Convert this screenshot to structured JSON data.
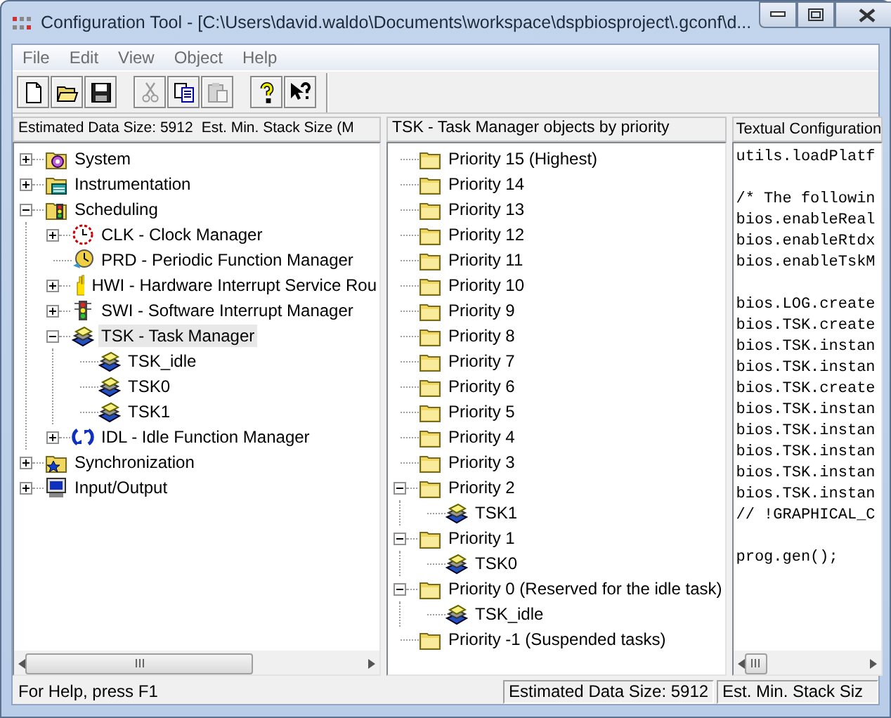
{
  "window": {
    "title": "Configuration Tool - [C:\\Users\\david.waldo\\Documents\\workspace\\dspbiosproject\\.gconf\\d..."
  },
  "menu": [
    "File",
    "Edit",
    "View",
    "Object",
    "Help"
  ],
  "toolbar": [
    {
      "kind": "new",
      "disabled": false
    },
    {
      "kind": "open",
      "disabled": false
    },
    {
      "kind": "save",
      "disabled": false
    },
    {
      "kind": "separator"
    },
    {
      "kind": "cut",
      "disabled": true
    },
    {
      "kind": "copy",
      "disabled": false
    },
    {
      "kind": "paste",
      "disabled": true
    },
    {
      "kind": "separator"
    },
    {
      "kind": "help",
      "disabled": false
    },
    {
      "kind": "context-help",
      "disabled": false
    }
  ],
  "left_pane": {
    "header": "Estimated Data Size: 5912",
    "header_2": "Est. Min. Stack Size (M",
    "tree": [
      {
        "label": "System",
        "kind": "system",
        "expanded": false,
        "selected": false
      },
      {
        "label": "Instrumentation",
        "kind": "instrumentation",
        "expanded": false,
        "selected": false
      },
      {
        "label": "Scheduling",
        "kind": "scheduling",
        "expanded": true,
        "selected": false,
        "children": [
          {
            "label": "CLK - Clock Manager",
            "kind": "clock",
            "expanded": false,
            "selected": false
          },
          {
            "label": "PRD - Periodic Function Manager",
            "kind": "periodic",
            "selected": false
          },
          {
            "label": "HWI - Hardware Interrupt Service Rou",
            "kind": "hand",
            "expanded": false,
            "selected": false
          },
          {
            "label": "SWI - Software Interrupt Manager",
            "kind": "signal",
            "expanded": false,
            "selected": false
          },
          {
            "label": "TSK - Task Manager",
            "kind": "task",
            "expanded": true,
            "selected": true,
            "children": [
              {
                "label": "TSK_idle",
                "kind": "task",
                "selected": false
              },
              {
                "label": "TSK0",
                "kind": "task",
                "selected": false
              },
              {
                "label": "TSK1",
                "kind": "task",
                "selected": false
              }
            ]
          },
          {
            "label": "IDL - Idle Function Manager",
            "kind": "idle",
            "expanded": false,
            "selected": false
          }
        ]
      },
      {
        "label": "Synchronization",
        "kind": "sync",
        "expanded": false,
        "selected": false
      },
      {
        "label": "Input/Output",
        "kind": "io",
        "expanded": false,
        "selected": false
      }
    ]
  },
  "middle_pane": {
    "header": "TSK - Task Manager objects by priority",
    "tree": [
      {
        "label": "Priority 15 (Highest)",
        "kind": "folder",
        "selected": false
      },
      {
        "label": "Priority 14",
        "kind": "folder",
        "selected": false
      },
      {
        "label": "Priority 13",
        "kind": "folder",
        "selected": false
      },
      {
        "label": "Priority 12",
        "kind": "folder",
        "selected": false
      },
      {
        "label": "Priority 11",
        "kind": "folder",
        "selected": false
      },
      {
        "label": "Priority 10",
        "kind": "folder",
        "selected": false
      },
      {
        "label": "Priority 9",
        "kind": "folder",
        "selected": false
      },
      {
        "label": "Priority 8",
        "kind": "folder",
        "selected": false
      },
      {
        "label": "Priority 7",
        "kind": "folder",
        "selected": false
      },
      {
        "label": "Priority 6",
        "kind": "folder",
        "selected": false
      },
      {
        "label": "Priority 5",
        "kind": "folder",
        "selected": false
      },
      {
        "label": "Priority 4",
        "kind": "folder",
        "selected": false
      },
      {
        "label": "Priority 3",
        "kind": "folder",
        "selected": false
      },
      {
        "label": "Priority 2",
        "kind": "folder",
        "expanded": true,
        "selected": false,
        "children": [
          {
            "label": "TSK1",
            "kind": "task",
            "selected": false
          }
        ]
      },
      {
        "label": "Priority 1",
        "kind": "folder",
        "expanded": true,
        "selected": false,
        "children": [
          {
            "label": "TSK0",
            "kind": "task",
            "selected": false
          }
        ]
      },
      {
        "label": "Priority 0 (Reserved for the idle task)",
        "kind": "folder",
        "expanded": true,
        "selected": false,
        "children": [
          {
            "label": "TSK_idle",
            "kind": "task",
            "selected": false
          }
        ]
      },
      {
        "label": "Priority -1 (Suspended tasks)",
        "kind": "folder",
        "selected": false
      }
    ]
  },
  "right_pane": {
    "header": "Textual Configuration",
    "code_blocks": [
      [
        "utils.loadPlatf"
      ],
      [
        "/* The followin",
        "bios.enableReal",
        "bios.enableRtdx",
        "bios.enableTskM"
      ],
      [
        "bios.LOG.create",
        "bios.TSK.create",
        "bios.TSK.instan",
        "bios.TSK.instan",
        "bios.TSK.create",
        "bios.TSK.instan",
        "bios.TSK.instan",
        "bios.TSK.instan",
        "bios.TSK.instan",
        "bios.TSK.instan",
        "// !GRAPHICAL_C"
      ],
      [
        "prog.gen();"
      ]
    ]
  },
  "status_bar": {
    "help": "For Help, press F1",
    "data_size": "Estimated Data Size: 5912",
    "stack_size": "Est. Min. Stack Siz"
  }
}
